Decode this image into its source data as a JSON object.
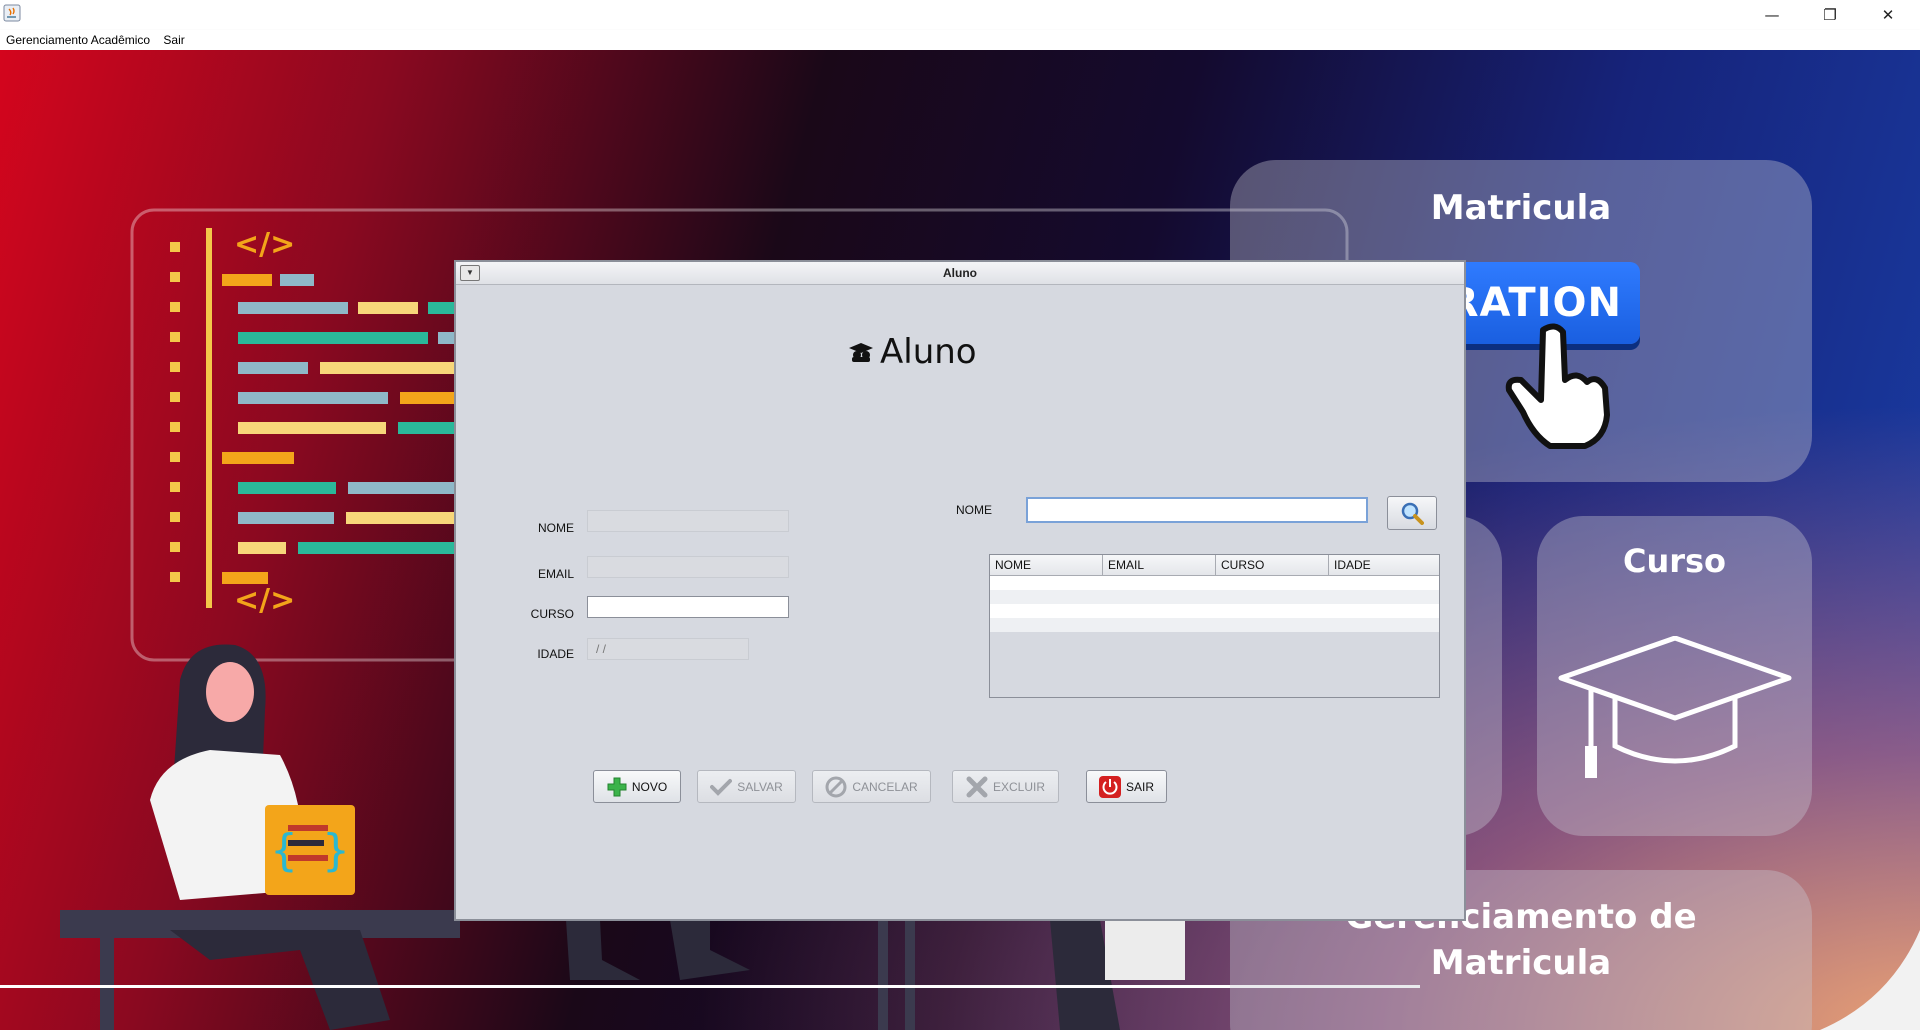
{
  "window": {
    "minimize": "—",
    "restore": "❐",
    "close": "✕"
  },
  "menu": [
    "Gerenciamento Acadêmico",
    "Sair"
  ],
  "background": {
    "card_matricula": "Matricula",
    "registration_button": "ISTRATION",
    "card_curso": "Curso",
    "card_gerenciamento_line1": "Gerenciamento de",
    "card_gerenciamento_line2": "Matricula"
  },
  "dialog": {
    "title": "Aluno",
    "heading": "Aluno",
    "heading_icon": "student-icon",
    "form": {
      "nome_label": "NOME",
      "email_label": "EMAIL",
      "curso_label": "CURSO",
      "idade_label": "IDADE",
      "idade_value": " /  /"
    },
    "search": {
      "label": "NOME",
      "value": "",
      "button_icon": "magnifier-icon"
    },
    "table": {
      "columns": [
        "NOME",
        "EMAIL",
        "CURSO",
        "IDADE"
      ],
      "rows": []
    },
    "buttons": {
      "novo": "NOVO",
      "salvar": "SALVAR",
      "cancelar": "CANCELAR",
      "excluir": "EXCLUIR",
      "sair": "SAIR"
    }
  },
  "colors": {
    "accent_blue": "#1a5fe0",
    "dialog_bg": "#d6d9e0",
    "sair_red": "#d42020",
    "novo_green": "#3bb34a"
  }
}
